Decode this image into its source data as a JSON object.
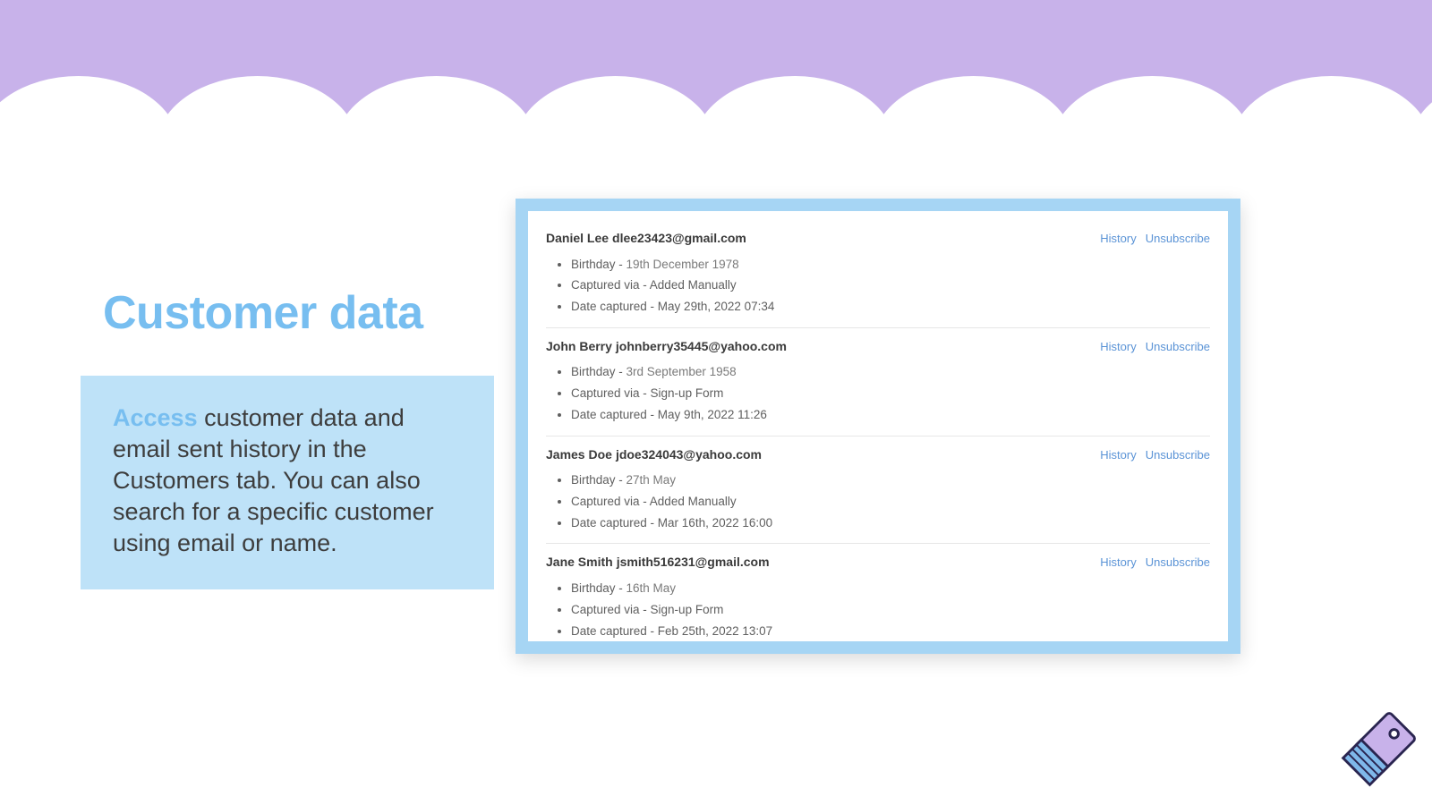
{
  "heading": "Customer data",
  "description": {
    "access_word": "Access",
    "rest": " customer data and email sent history in the Customers tab. You can also search for a specific customer using email or name."
  },
  "labels": {
    "birthday": "Birthday - ",
    "captured_via": "Captured via - ",
    "date_captured": "Date captured - ",
    "history": "History",
    "unsubscribe": "Unsubscribe"
  },
  "customers": [
    {
      "name": "Daniel Lee",
      "email": "dlee23423@gmail.com",
      "birthday": "19th December 1978",
      "captured_via": "Added Manually",
      "date_captured": "May 29th, 2022 07:34"
    },
    {
      "name": "John Berry",
      "email": "johnberry35445@yahoo.com",
      "birthday": "3rd September 1958",
      "captured_via": "Sign-up Form",
      "date_captured": "May 9th, 2022 11:26"
    },
    {
      "name": "James Doe",
      "email": "jdoe324043@yahoo.com",
      "birthday": "27th May",
      "captured_via": "Added Manually",
      "date_captured": "Mar 16th, 2022 16:00"
    },
    {
      "name": "Jane Smith",
      "email": "jsmith516231@gmail.com",
      "birthday": "16th May",
      "captured_via": "Sign-up Form",
      "date_captured": "Feb 25th, 2022 13:07"
    }
  ]
}
